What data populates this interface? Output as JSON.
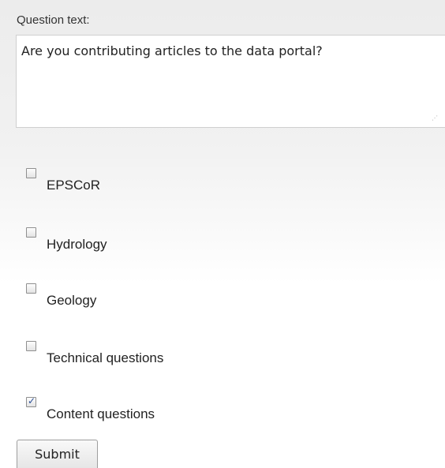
{
  "form": {
    "question_label": "Question text:",
    "question_value": "Are you contributing articles to the data portal?",
    "options": [
      {
        "label": "EPSCoR",
        "checked": false
      },
      {
        "label": "Hydrology",
        "checked": false
      },
      {
        "label": "Geology",
        "checked": false
      },
      {
        "label": "Technical questions",
        "checked": false
      },
      {
        "label": "Content questions",
        "checked": true
      }
    ],
    "submit_label": "Submit"
  }
}
